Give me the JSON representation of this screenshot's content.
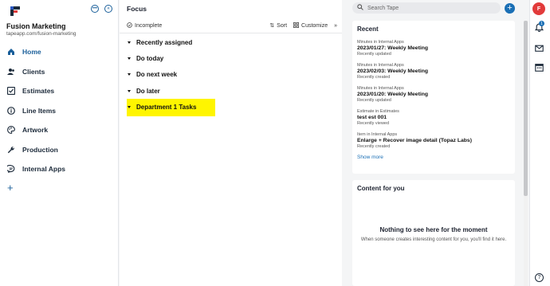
{
  "sidebar": {
    "org_name": "Fusion Marketing",
    "org_url": "tapeapp.com/fusion-marketing",
    "more_icon": "more-horizontal-icon",
    "collapse_icon": "chevrons-left-icon",
    "items": [
      {
        "label": "Home",
        "icon": "home-icon"
      },
      {
        "label": "Clients",
        "icon": "users-icon"
      },
      {
        "label": "Estimates",
        "icon": "checklist-icon"
      },
      {
        "label": "Line Items",
        "icon": "info-icon"
      },
      {
        "label": "Artwork",
        "icon": "palette-icon"
      },
      {
        "label": "Production",
        "icon": "wrench-icon"
      },
      {
        "label": "Internal Apps",
        "icon": "chat-icon"
      }
    ]
  },
  "focus": {
    "title": "Focus",
    "filter_label": "Incomplete",
    "sort_label": "Sort",
    "customize_label": "Customize",
    "sections": [
      {
        "label": "Recently assigned"
      },
      {
        "label": "Do today"
      },
      {
        "label": "Do next week"
      },
      {
        "label": "Do later"
      },
      {
        "label": "Department 1 Tasks"
      }
    ]
  },
  "search": {
    "placeholder": "Search Tape"
  },
  "recent": {
    "title": "Recent",
    "items": [
      {
        "category": "Minutes in Internal Apps",
        "title": "2023/01/27: Weekly Meeting",
        "status": "Recently updated"
      },
      {
        "category": "Minutes in Internal Apps",
        "title": "2023/02/03: Weekly Meeting",
        "status": "Recently created"
      },
      {
        "category": "Minutes in Internal Apps",
        "title": "2023/01/20: Weekly Meeting",
        "status": "Recently updated"
      },
      {
        "category": "Estimate in Estimates",
        "title": "test est 001",
        "status": "Recently viewed"
      },
      {
        "category": "Item in Internal Apps",
        "title": "Enlarge + Recover image detail (Topaz Labs)",
        "status": "Recently created"
      }
    ],
    "show_more": "Show more"
  },
  "content_for_you": {
    "title": "Content for you",
    "empty_title": "Nothing to see here for the moment",
    "empty_subtitle": "When someone creates interesting content for you, you'll find it here."
  },
  "rail": {
    "avatar_initials": "F",
    "notification_count": "1"
  },
  "colors": {
    "accent": "#1a6fb5",
    "highlight": "#fff500",
    "avatar": "#e23b3b"
  }
}
